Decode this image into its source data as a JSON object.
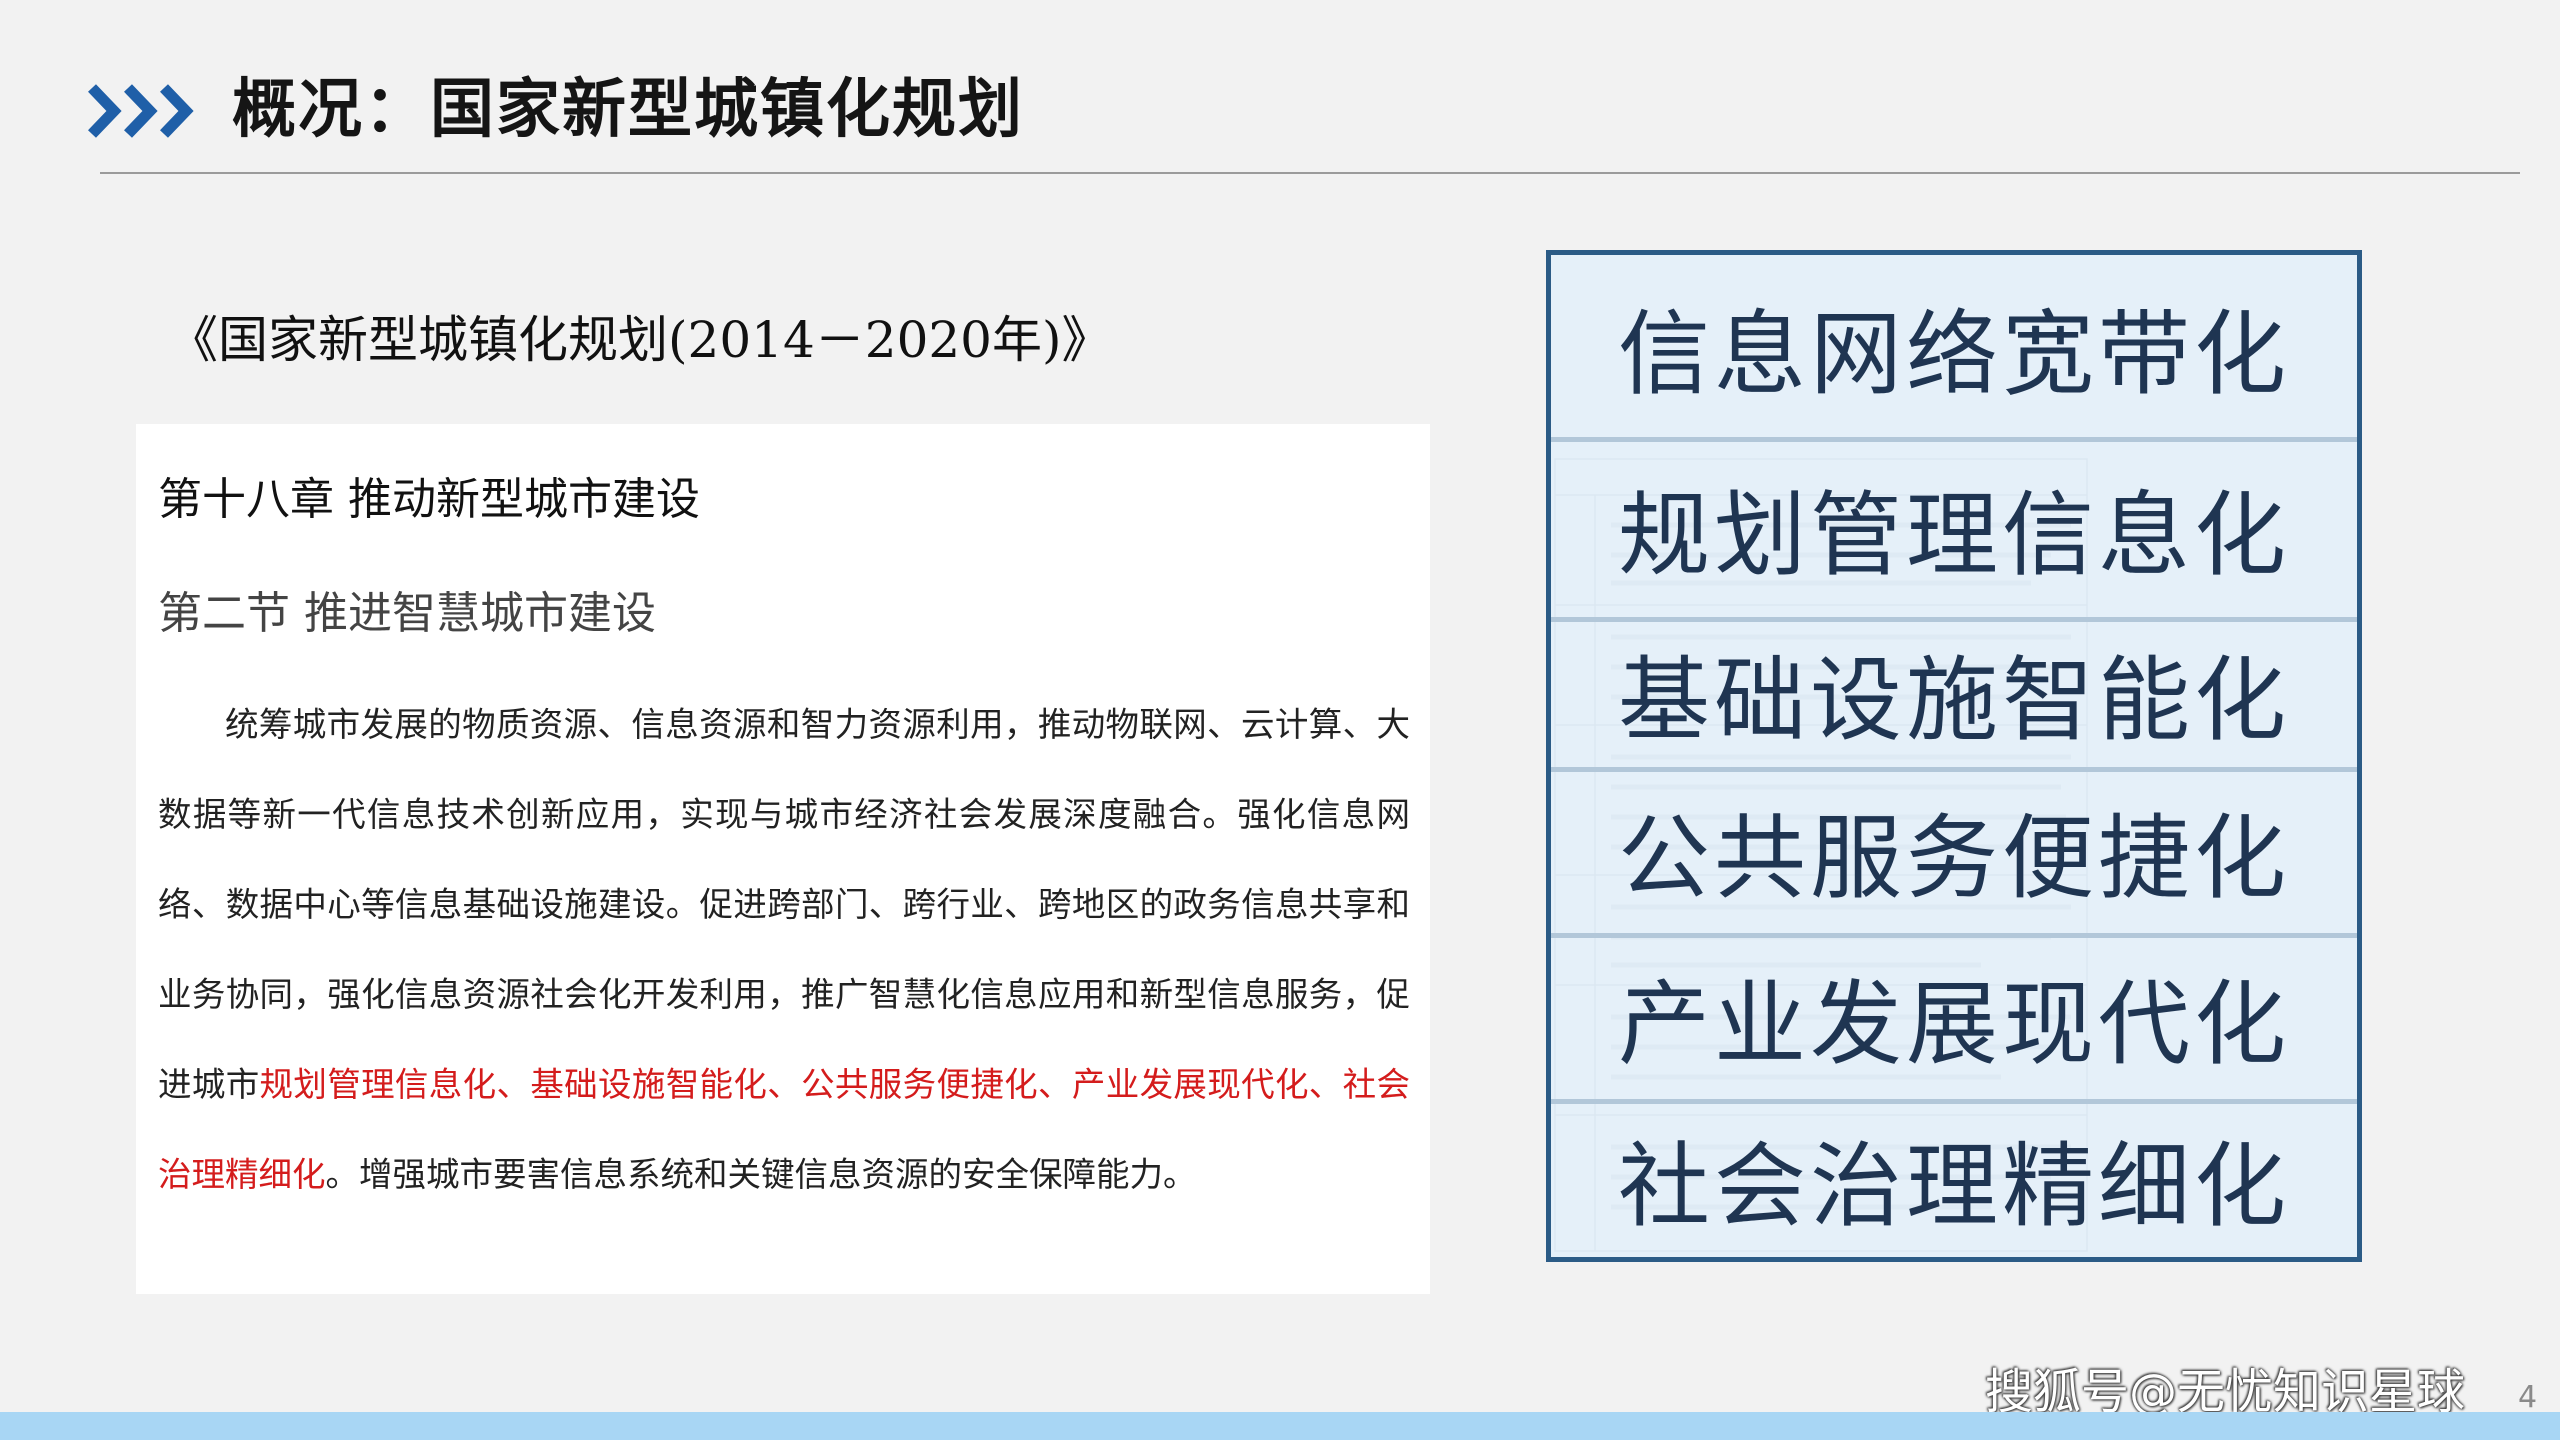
{
  "header": {
    "icon": "triple-chevron-right-icon",
    "title": "概况：国家新型城镇化规划"
  },
  "document": {
    "title": "《国家新型城镇化规划(2014－2020年)》",
    "chapter": "第十八章  推动新型城市建设",
    "section": "第二节  推进智慧城市建设",
    "paragraph_intro": "统筹城市发展的物质资源、信息资源和智力资源利用，推动物联网、云计算、大数据等新一代信息技术创新应用，实现与城市经济社会发展深度融合。强化信息网络、数据中心等信息基础设施建设。促进跨部门、跨行业、跨地区的政务信息共享和业务协同，强化信息资源社会化开发利用，推广智慧化信息应用和新型信息服务，促进城市",
    "paragraph_highlight": "规划管理信息化、基础设施智能化、公共服务便捷化、产业发展现代化、社会治理精细化",
    "paragraph_outro": "。增强城市要害信息系统和关键信息资源的安全保障能力。"
  },
  "boxes": [
    "信息网络宽带化",
    "规划管理信息化",
    "基础设施智能化",
    "公共服务便捷化",
    "产业发展现代化",
    "社会治理精细化"
  ],
  "footer": {
    "watermark": "搜狐号@无忧知识星球",
    "page_number": "4"
  },
  "colors": {
    "highlight": "#d41c1c",
    "box_border": "#2b5b86",
    "box_fill": "#e1eef8",
    "footer_bar": "#a8d6f4",
    "icon": "#1f5fa8"
  }
}
